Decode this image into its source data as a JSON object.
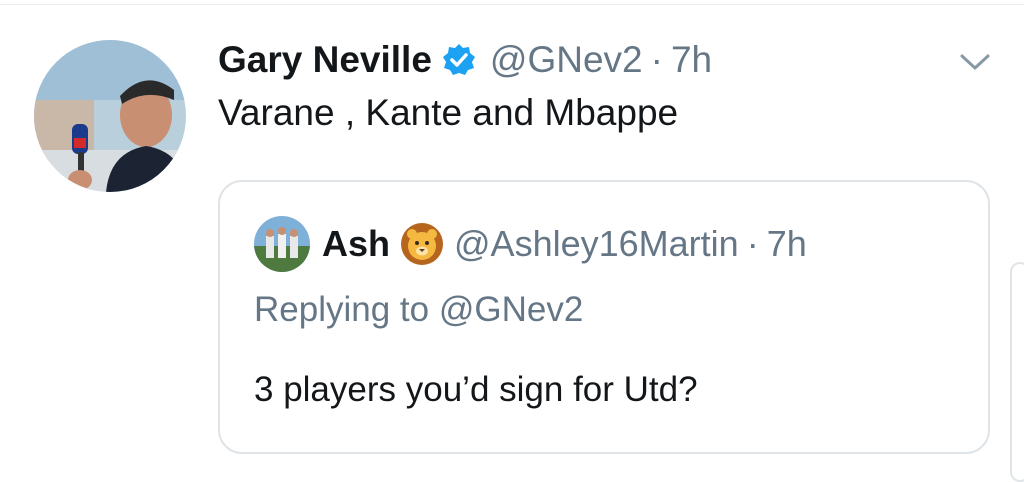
{
  "tweet": {
    "author_name": "Gary Neville",
    "author_handle": "@GNev2",
    "separator": "·",
    "time": "7h",
    "text": "Varane , Kante and Mbappe",
    "verified": true
  },
  "quoted_tweet": {
    "author_name": "Ash",
    "author_handle": "@Ashley16Martin",
    "separator": "·",
    "time": "7h",
    "replying_prefix": "Replying to",
    "replying_mention": "@GNev2",
    "text": "3 players you’d sign for Utd?"
  },
  "icons": {
    "verified": "verified-badge-icon",
    "more": "chevron-down-icon",
    "emoji": "lion-face-emoji"
  },
  "colors": {
    "primary_text": "#14171a",
    "secondary_text": "#657786",
    "verified_blue": "#1da1f2",
    "border": "#dfe4e8"
  }
}
